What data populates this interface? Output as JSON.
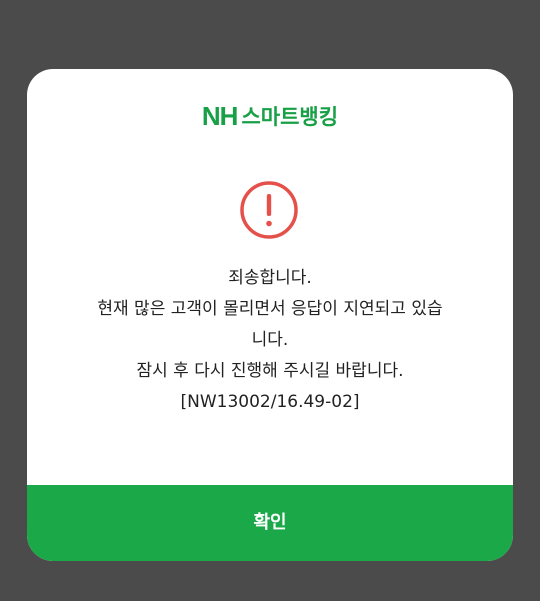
{
  "dialog": {
    "logo": {
      "brand": "NH",
      "service": "스마트뱅킹"
    },
    "icon": "alert-circle-icon",
    "message_lines": [
      "죄송합니다.",
      "현재 많은 고객이 몰리면서 응답이 지연되고 있습",
      "니다.",
      "잠시 후 다시 진행해 주시길 바랍니다.",
      "[NW13002/16.49-02]"
    ],
    "confirm_label": "확인"
  },
  "colors": {
    "background": "#4b4b4b",
    "brand_green": "#17a046",
    "button_green": "#1aa849",
    "alert_red": "#e5504a"
  }
}
